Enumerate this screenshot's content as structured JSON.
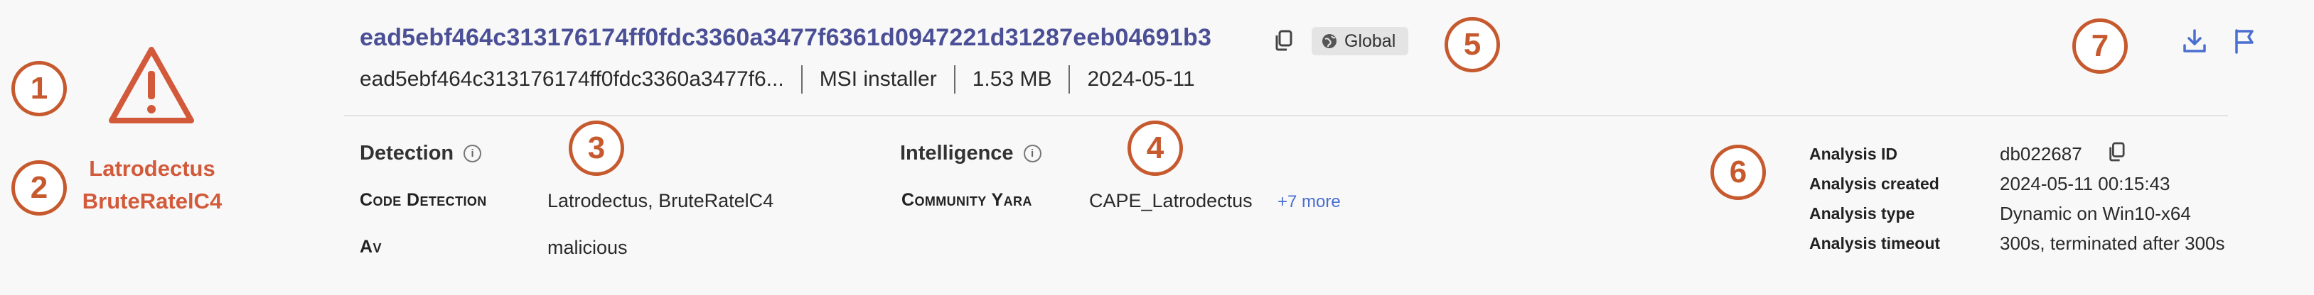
{
  "callouts": [
    "1",
    "2",
    "3",
    "4",
    "5",
    "6",
    "7"
  ],
  "threat": {
    "name_line1": "Latrodectus",
    "name_line2": "BruteRatelC4"
  },
  "header": {
    "hash": "ead5ebf464c313176174ff0fdc3360a3477f6361d0947221d31287eeb04691b3",
    "visibility_badge": "Global",
    "meta": {
      "short_hash": "ead5ebf464c313176174ff0fdc3360a3477f6...",
      "file_type": "MSI installer",
      "file_size": "1.53 MB",
      "date": "2024-05-11"
    }
  },
  "detection": {
    "title": "Detection",
    "rows": [
      {
        "label": "Code Detection",
        "value": "Latrodectus, BruteRatelC4"
      },
      {
        "label": "Av",
        "value": "malicious"
      }
    ]
  },
  "intelligence": {
    "title": "Intelligence",
    "rows": [
      {
        "label": "Community Yara",
        "value": "CAPE_Latrodectus",
        "more": "+7 more"
      }
    ]
  },
  "analysis": {
    "rows": [
      {
        "key": "Analysis ID",
        "value": "db022687"
      },
      {
        "key": "Analysis created",
        "value": "2024-05-11 00:15:43"
      },
      {
        "key": "Analysis type",
        "value": "Dynamic on Win10-x64"
      },
      {
        "key": "Analysis timeout",
        "value": "300s, terminated after 300s"
      }
    ]
  },
  "icons": {
    "warning": "warning-triangle-icon",
    "copy": "copy-icon",
    "globe": "globe-icon",
    "info": "info-icon",
    "download": "download-icon",
    "flag": "flag-icon"
  },
  "colors": {
    "accent_orange": "#c65a2e",
    "threat_red": "#d25a3a",
    "hash_purple": "#4a4f96",
    "action_blue": "#4a6fd0",
    "background": "#f8f8f8"
  }
}
